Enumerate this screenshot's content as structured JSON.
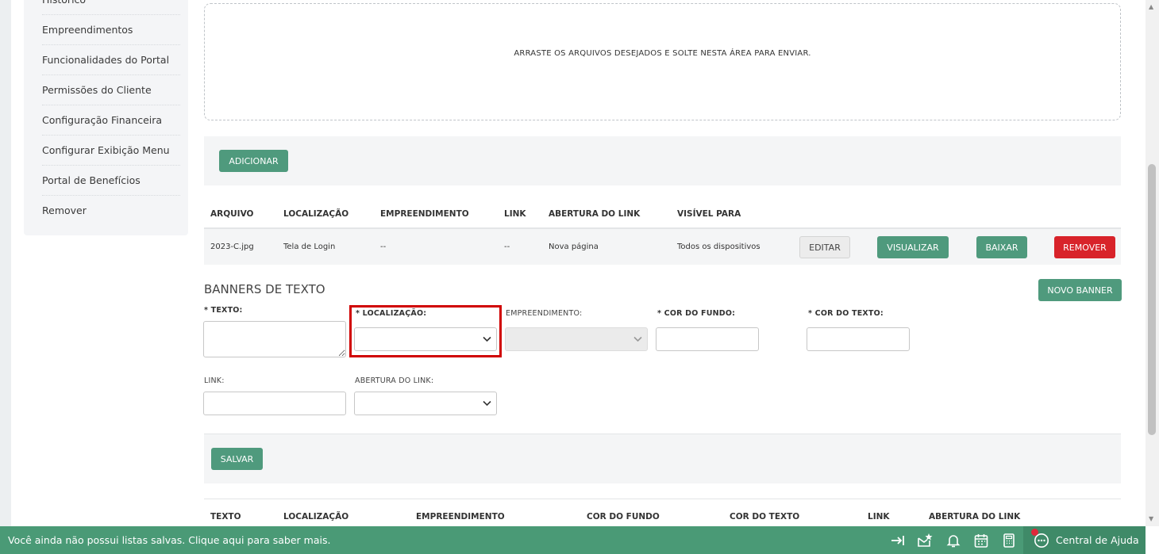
{
  "sidebar": {
    "items": [
      {
        "label": "Histórico"
      },
      {
        "label": "Empreendimentos"
      },
      {
        "label": "Funcionalidades do Portal"
      },
      {
        "label": "Permissões do Cliente"
      },
      {
        "label": "Configuração Financeira"
      },
      {
        "label": "Configurar Exibição Menu"
      },
      {
        "label": "Portal de Benefícios"
      },
      {
        "label": "Remover"
      }
    ]
  },
  "dropzone": {
    "text": "ARRASTE OS ARQUIVOS DESEJADOS E SOLTE NESTA ÁREA PARA ENVIAR."
  },
  "upload": {
    "add_label": "ADICIONAR"
  },
  "files_table": {
    "headers": [
      "ARQUIVO",
      "LOCALIZAÇÃO",
      "EMPREENDIMENTO",
      "LINK",
      "ABERTURA DO LINK",
      "VISÍVEL PARA"
    ],
    "rows": [
      {
        "arquivo": "2023-C.jpg",
        "localizacao": "Tela de Login",
        "empreendimento": "--",
        "link": "--",
        "abertura": "Nova página",
        "visivel": "Todos os dispositivos",
        "edit_label": "EDITAR",
        "view_label": "VISUALIZAR",
        "download_label": "BAIXAR",
        "remove_label": "REMOVER"
      }
    ]
  },
  "text_banners": {
    "title": "BANNERS DE TEXTO",
    "new_label": "NOVO BANNER",
    "fields": {
      "texto": "* TEXTO:",
      "localizacao": "* LOCALIZAÇÃO:",
      "empreendimento": "EMPREENDIMENTO:",
      "cor_fundo": "* COR DO FUNDO:",
      "cor_texto": "* COR DO TEXTO:",
      "link": "LINK:",
      "abertura": "ABERTURA DO LINK:"
    },
    "save_label": "SALVAR",
    "table_headers": [
      "TEXTO",
      "LOCALIZAÇÃO",
      "EMPREENDIMENTO",
      "COR DO FUNDO",
      "COR DO TEXTO",
      "LINK",
      "ABERTURA DO LINK"
    ]
  },
  "footer": {
    "message": "Você ainda não possui listas salvas. Clique aqui para saber mais.",
    "help_label": "Central de Ajuda"
  },
  "colors": {
    "primary_green": "#4f9a7d",
    "footer_green": "#4a9a76",
    "danger_red": "#d8232a",
    "highlight": "#d00000"
  }
}
